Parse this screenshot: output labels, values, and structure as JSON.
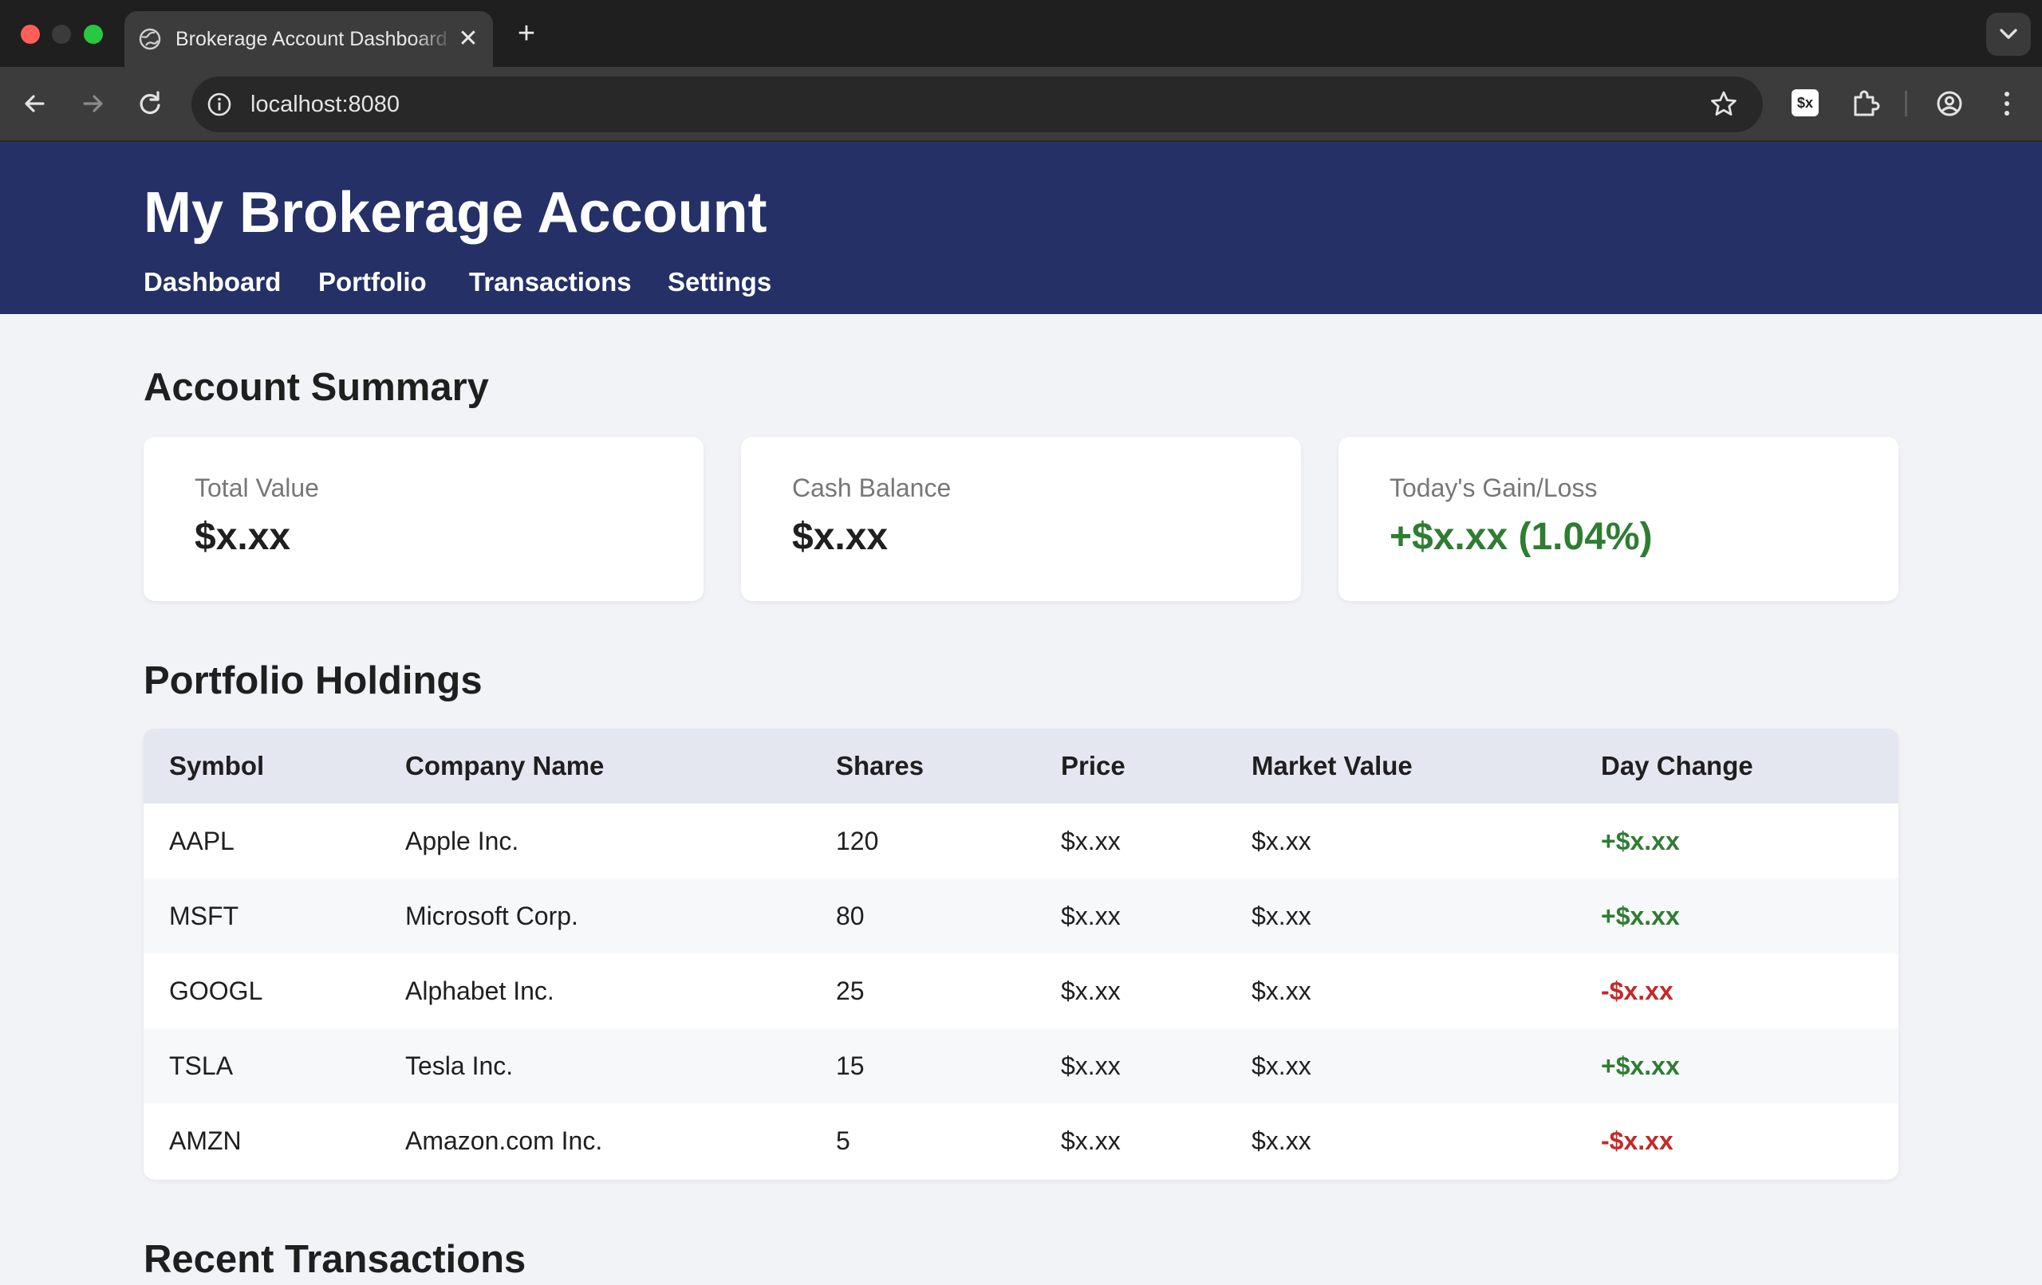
{
  "browser": {
    "tab_title": "Brokerage Account Dashboard",
    "tab_close": "✕",
    "new_tab": "+",
    "url": "localhost:8080",
    "extension_badge": "$x"
  },
  "header": {
    "title": "My Brokerage Account",
    "nav": [
      "Dashboard",
      "Portfolio",
      "Transactions",
      "Settings"
    ]
  },
  "account_summary": {
    "heading": "Account Summary",
    "cards": [
      {
        "label": "Total Value",
        "value": "$x.xx"
      },
      {
        "label": "Cash Balance",
        "value": "$x.xx"
      },
      {
        "label": "Today's Gain/Loss",
        "value": "+$x.xx (1.04%)"
      }
    ]
  },
  "holdings": {
    "heading": "Portfolio Holdings",
    "columns": [
      "Symbol",
      "Company Name",
      "Shares",
      "Price",
      "Market Value",
      "Day Change"
    ],
    "rows": [
      [
        "AAPL",
        "Apple Inc.",
        "120",
        "$x.xx",
        "$x.xx",
        "+$x.xx"
      ],
      [
        "MSFT",
        "Microsoft Corp.",
        "80",
        "$x.xx",
        "$x.xx",
        "+$x.xx"
      ],
      [
        "GOOGL",
        "Alphabet Inc.",
        "25",
        "$x.xx",
        "$x.xx",
        "-$x.xx"
      ],
      [
        "TSLA",
        "Tesla Inc.",
        "15",
        "$x.xx",
        "$x.xx",
        "+$x.xx"
      ],
      [
        "AMZN",
        "Amazon.com Inc.",
        "5",
        "$x.xx",
        "$x.xx",
        "-$x.xx"
      ]
    ]
  },
  "transactions": {
    "heading": "Recent Transactions"
  },
  "colors": {
    "header_bg": "#243066",
    "gain": "#2e7d32",
    "loss": "#c62828"
  }
}
